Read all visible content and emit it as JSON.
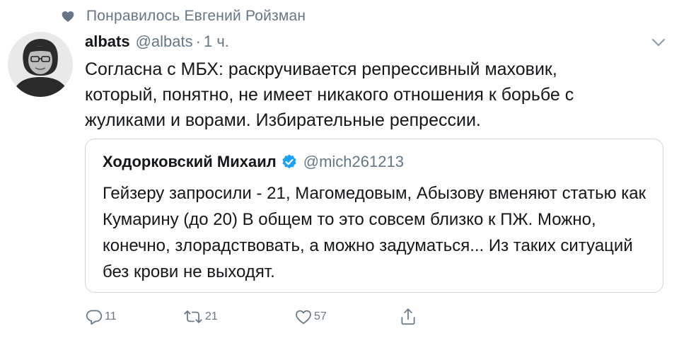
{
  "social_context": {
    "text": "Понравилось Евгений Ройзман",
    "icon": "heart-filled-icon"
  },
  "tweet": {
    "author_name": "albats",
    "handle": "@albats",
    "separator": "·",
    "time": "1 ч.",
    "text": "Согласна с МБХ: раскручивается репрессивный  маховик, который, понятно, не имеет никакого отношения к борьбе с жуликами и ворами. Избирательные репрессии."
  },
  "quote": {
    "author_name": "Ходорковский Михаил",
    "verified": true,
    "handle": "@mich261213",
    "text": "Гейзеру запросили - 21, Магомедовым, Абызову вменяют статью как Кумарину (до 20) В общем то это совсем близко к ПЖ. Можно, конечно, злорадствовать, а можно задуматься... Из таких ситуаций без крови не выходят."
  },
  "actions": {
    "replies": "11",
    "retweets": "21",
    "likes": "57"
  },
  "colors": {
    "text_primary": "#14171a",
    "text_secondary": "#657786",
    "border": "#ccd6dd",
    "verified_blue": "#1da1f2"
  }
}
